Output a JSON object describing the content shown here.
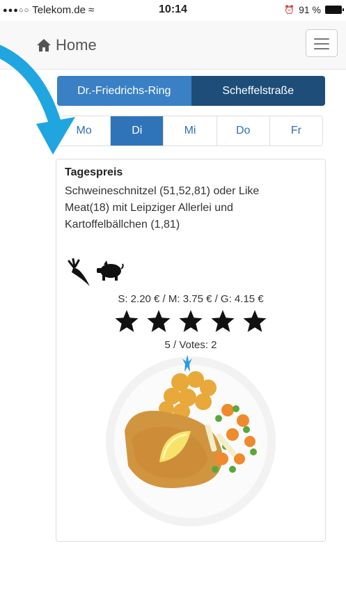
{
  "status_bar": {
    "signal_dots": "●●●○○",
    "carrier": "Telekom.de",
    "wifi": "≈",
    "time": "10:14",
    "alarm": "⏰",
    "battery": "91 %"
  },
  "nav": {
    "home_label": "Home"
  },
  "locations": [
    {
      "label": "Dr.-Friedrichs-Ring"
    },
    {
      "label": "Scheffelstraße"
    }
  ],
  "days": [
    {
      "label": "Mo"
    },
    {
      "label": "Di"
    },
    {
      "label": "Mi"
    },
    {
      "label": "Do"
    },
    {
      "label": "Fr"
    }
  ],
  "meal": {
    "title": "Tagespreis",
    "description": "Schweineschnitzel (51,52,81) oder Like Meat(18) mit Leipziger Allerlei und Kartoffelbällchen (1,81)",
    "price": "S: 2.20 € / M: 3.75 € / G: 4.15 €",
    "rating": 5,
    "rating_max": 5,
    "votes_text": "5 / Votes: 2",
    "diet_icons": [
      "carrot-icon",
      "pig-icon"
    ]
  },
  "colors": {
    "location_active": "#3a80c4",
    "location_inactive": "#1e4d79",
    "day_active": "#2f74b8",
    "day_text": "#2f6fb3",
    "arrow": "#1fa6e0"
  }
}
